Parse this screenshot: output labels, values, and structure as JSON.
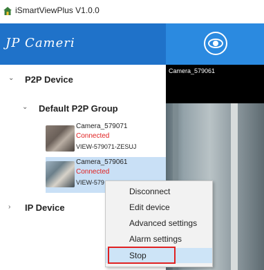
{
  "window": {
    "title": "iSmartViewPlus  V1.0.0",
    "icon": "app-house-icon"
  },
  "sidebar": {
    "logo_text": "JP Cameri",
    "p2p_device": {
      "label": "P2P Device",
      "chevron": "chevron-down-icon"
    },
    "group": {
      "label": "Default P2P Group",
      "chevron": "chevron-down-icon"
    },
    "cameras": [
      {
        "name": "Camera_579071",
        "status": "Connected",
        "id": "VIEW-579071-ZESUJ"
      },
      {
        "name": "Camera_579061",
        "status": "Connected",
        "id": "VIEW-579"
      }
    ],
    "ip_device": {
      "label": "IP Device",
      "chevron": "chevron-right-icon"
    }
  },
  "viewer": {
    "toolbar_icon": "eye-icon",
    "video_label": "Camera_579061"
  },
  "context_menu": {
    "items": [
      "Disconnect",
      "Edit device",
      "Advanced settings",
      "Alarm settings",
      "Stop"
    ],
    "highlighted": "Stop"
  },
  "colors": {
    "header_blue": "#1f72c9",
    "toolbar_blue": "#2b8ae0",
    "connected_red": "#e02020",
    "selection_blue": "#c9e0f6"
  }
}
